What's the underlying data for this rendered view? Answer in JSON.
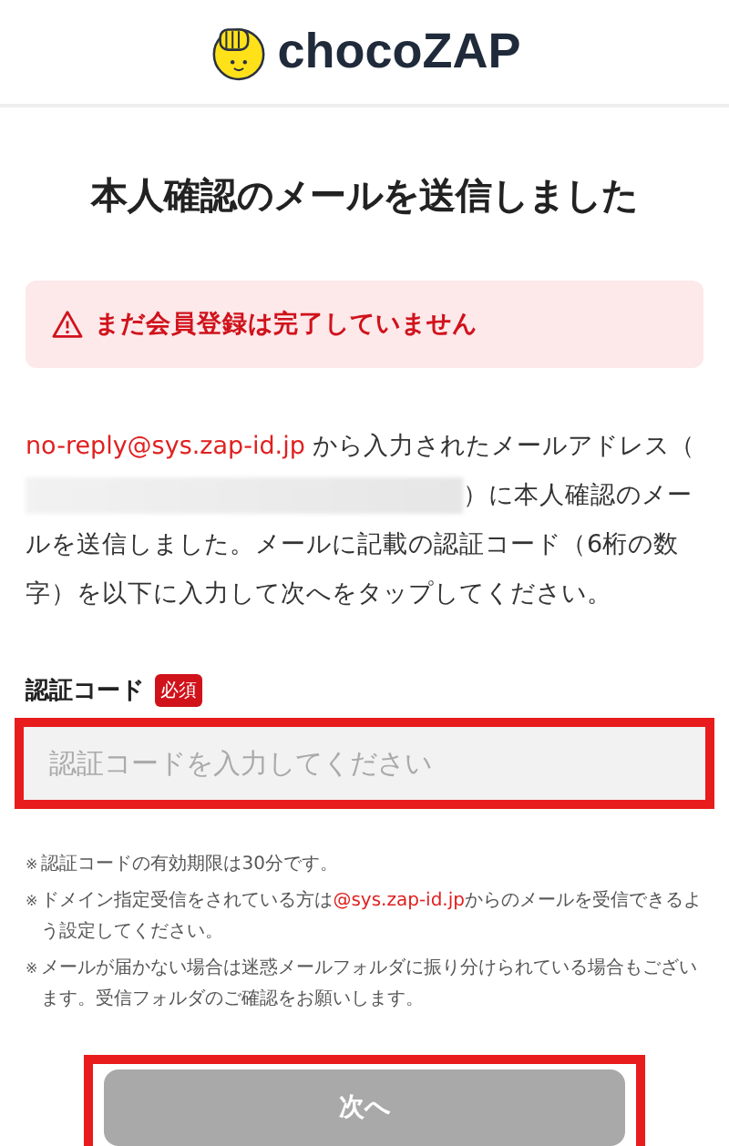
{
  "header": {
    "logo_text": "chocoZAP"
  },
  "title": "本人確認のメールを送信しました",
  "alert": {
    "text": "まだ会員登録は完了していません"
  },
  "intro": {
    "sender": "no-reply@sys.zap-id.jp",
    "before": " から入力されたメールアドレス（",
    "after": "）に本人確認のメールを送信しました。メールに記載の認証コード（6桁の数字）を以下に入力して次へをタップしてください。"
  },
  "code_field": {
    "label": "認証コード",
    "required_badge": "必須",
    "placeholder": "認証コードを入力してください",
    "highlighted": true
  },
  "notes": [
    {
      "mark": "※",
      "parts": [
        {
          "text": "認証コードの有効期限は30分です。",
          "emphasis": false
        }
      ]
    },
    {
      "mark": "※",
      "parts": [
        {
          "text": "ドメイン指定受信をされている方は",
          "emphasis": false
        },
        {
          "text": "@sys.zap-id.jp",
          "emphasis": true
        },
        {
          "text": "からのメールを受信できるよう設定してください。",
          "emphasis": false
        }
      ]
    },
    {
      "mark": "※",
      "parts": [
        {
          "text": "メールが届かない場合は迷惑メールフォルダに振り分けられている場合もございます。受信フォルダのご確認をお願いします。",
          "emphasis": false
        }
      ]
    }
  ],
  "next_button": {
    "label": "次へ",
    "disabled": true,
    "highlighted": true
  }
}
